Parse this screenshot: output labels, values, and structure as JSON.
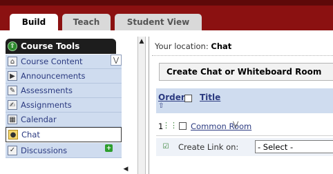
{
  "tabs": [
    {
      "label": "Build",
      "active": true
    },
    {
      "label": "Teach",
      "active": false
    },
    {
      "label": "Student View",
      "active": false
    }
  ],
  "sidebar": {
    "header": "Course Tools",
    "items": [
      {
        "label": "Course Content",
        "icon": "home-icon",
        "active": false
      },
      {
        "label": "Announcements",
        "icon": "megaphone-icon",
        "active": false
      },
      {
        "label": "Assessments",
        "icon": "assessment-icon",
        "active": false
      },
      {
        "label": "Assignments",
        "icon": "assignment-icon",
        "active": false
      },
      {
        "label": "Calendar",
        "icon": "calendar-icon",
        "active": false
      },
      {
        "label": "Chat",
        "icon": "chat-icon",
        "active": true
      },
      {
        "label": "Discussions",
        "icon": "discussions-icon",
        "active": false
      }
    ]
  },
  "location": {
    "prefix": "Your location:",
    "current": "Chat"
  },
  "toolbar": {
    "create_label": "Create Chat or Whiteboard Room"
  },
  "table": {
    "headers": {
      "order": "Order",
      "title": "Title"
    },
    "rows": [
      {
        "order": "1",
        "title": "Common Room"
      }
    ]
  },
  "create_link": {
    "label": "Create Link on:",
    "select_value": "- Select -"
  },
  "colors": {
    "banner": "#8b1111",
    "nav_bg": "#cfdcef",
    "link": "#2b3a80"
  }
}
